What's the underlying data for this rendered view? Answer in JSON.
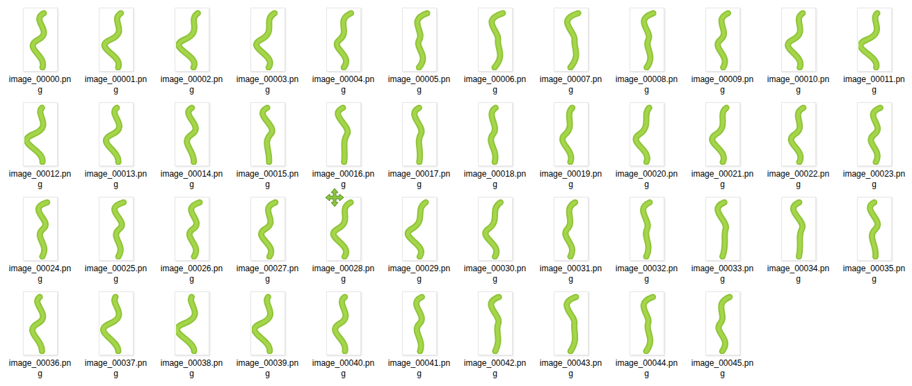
{
  "files": [
    {
      "name": "image_00000.png",
      "selected": false
    },
    {
      "name": "image_00001.png",
      "selected": false
    },
    {
      "name": "image_00002.png",
      "selected": false
    },
    {
      "name": "image_00003.png",
      "selected": false
    },
    {
      "name": "image_00004.png",
      "selected": false
    },
    {
      "name": "image_00005.png",
      "selected": false
    },
    {
      "name": "image_00006.png",
      "selected": false
    },
    {
      "name": "image_00007.png",
      "selected": false
    },
    {
      "name": "image_00008.png",
      "selected": false
    },
    {
      "name": "image_00009.png",
      "selected": false
    },
    {
      "name": "image_00010.png",
      "selected": false
    },
    {
      "name": "image_00011.png",
      "selected": false
    },
    {
      "name": "image_00012.png",
      "selected": false
    },
    {
      "name": "image_00013.png",
      "selected": false
    },
    {
      "name": "image_00014.png",
      "selected": false
    },
    {
      "name": "image_00015.png",
      "selected": false
    },
    {
      "name": "image_00016.png",
      "selected": false
    },
    {
      "name": "image_00017.png",
      "selected": false
    },
    {
      "name": "image_00018.png",
      "selected": false
    },
    {
      "name": "image_00019.png",
      "selected": false
    },
    {
      "name": "image_00020.png",
      "selected": false
    },
    {
      "name": "image_00021.png",
      "selected": false
    },
    {
      "name": "image_00022.png",
      "selected": false
    },
    {
      "name": "image_00023.png",
      "selected": false
    },
    {
      "name": "image_00024.png",
      "selected": false
    },
    {
      "name": "image_00025.png",
      "selected": false
    },
    {
      "name": "image_00026.png",
      "selected": false
    },
    {
      "name": "image_00027.png",
      "selected": false
    },
    {
      "name": "image_00028.png",
      "selected": false
    },
    {
      "name": "image_00029.png",
      "selected": false
    },
    {
      "name": "image_00030.png",
      "selected": false
    },
    {
      "name": "image_00031.png",
      "selected": false
    },
    {
      "name": "image_00032.png",
      "selected": false
    },
    {
      "name": "image_00033.png",
      "selected": false
    },
    {
      "name": "image_00034.png",
      "selected": false
    },
    {
      "name": "image_00035.png",
      "selected": false
    },
    {
      "name": "image_00036.png",
      "selected": false
    },
    {
      "name": "image_00037.png",
      "selected": false
    },
    {
      "name": "image_00038.png",
      "selected": false
    },
    {
      "name": "image_00039.png",
      "selected": false
    },
    {
      "name": "image_00040.png",
      "selected": false
    },
    {
      "name": "image_00041.png",
      "selected": false
    },
    {
      "name": "image_00042.png",
      "selected": false
    },
    {
      "name": "image_00043.png",
      "selected": false
    },
    {
      "name": "image_00044.png",
      "selected": false
    },
    {
      "name": "image_00045.png",
      "selected": false
    }
  ]
}
